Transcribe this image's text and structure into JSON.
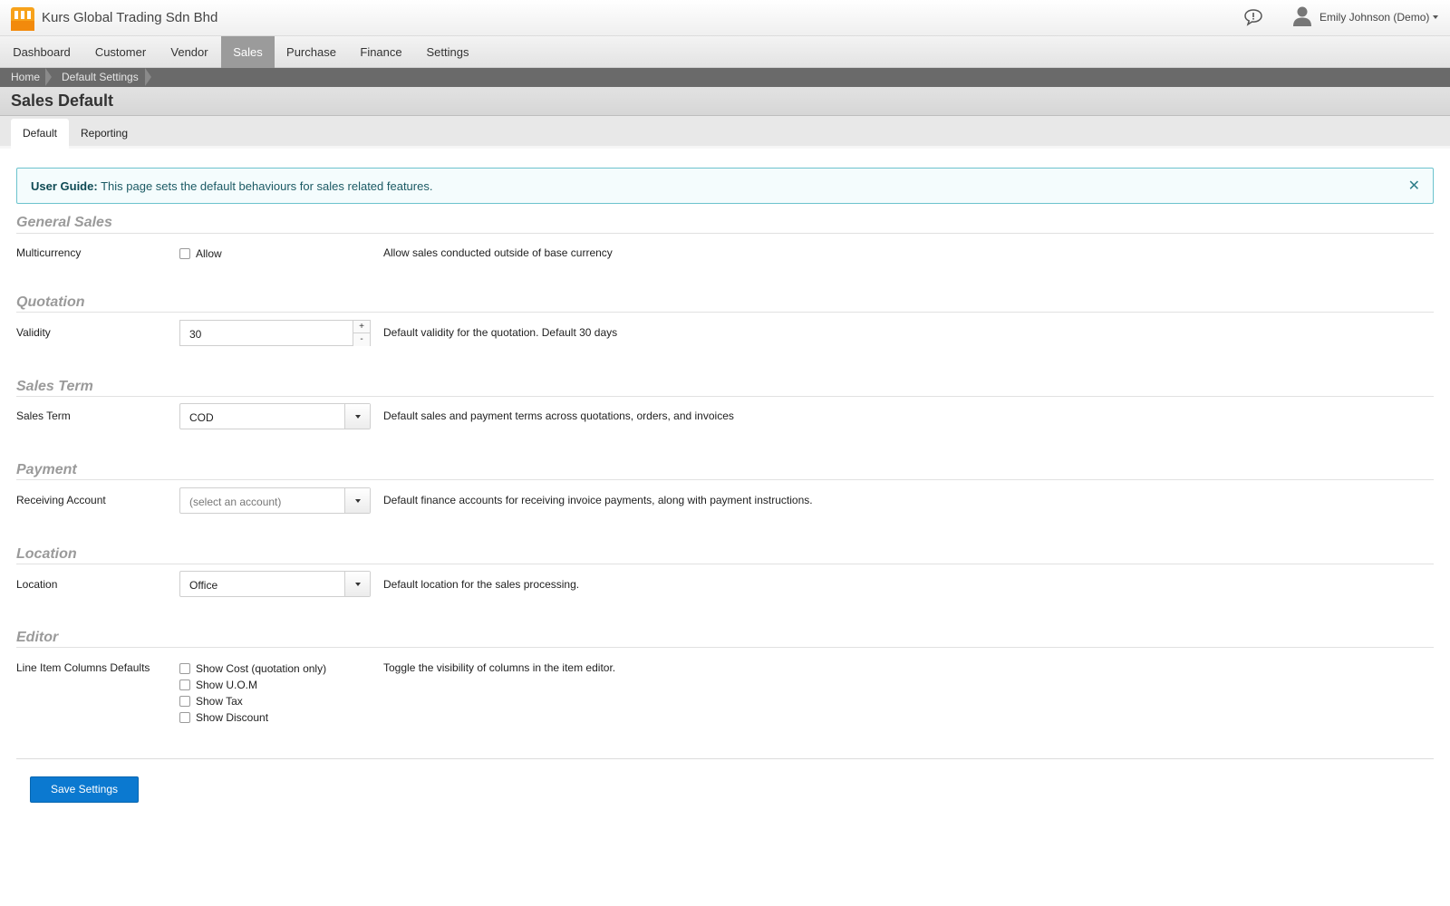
{
  "app": {
    "company_name": "Kurs Global Trading Sdn Bhd",
    "user_name": "Emily Johnson (Demo)",
    "logo_color": "#f7a21b"
  },
  "nav": {
    "items": [
      {
        "label": "Dashboard"
      },
      {
        "label": "Customer"
      },
      {
        "label": "Vendor"
      },
      {
        "label": "Sales",
        "active": true
      },
      {
        "label": "Purchase"
      },
      {
        "label": "Finance"
      },
      {
        "label": "Settings"
      }
    ]
  },
  "breadcrumb": {
    "items": [
      "Home",
      "Default Settings"
    ]
  },
  "page": {
    "title": "Sales Default"
  },
  "tabs": [
    {
      "label": "Default",
      "active": true
    },
    {
      "label": "Reporting"
    }
  ],
  "alert": {
    "strong": "User Guide:",
    "text": "This page sets the default behaviours for sales related features.",
    "close_glyph": "✕"
  },
  "sections": {
    "general": {
      "title": "General Sales",
      "label": "Multicurrency",
      "checkbox_label": "Allow",
      "checked": false,
      "description": "Allow sales conducted outside of base currency"
    },
    "quotation": {
      "title": "Quotation",
      "label": "Validity",
      "value": "30",
      "up": "+",
      "down": "-",
      "description": "Default validity for the quotation. Default 30 days"
    },
    "sales_term": {
      "title": "Sales Term",
      "label": "Sales Term",
      "value": "COD",
      "description": "Default sales and payment terms across quotations, orders, and invoices"
    },
    "payment": {
      "title": "Payment",
      "label": "Receiving Account",
      "placeholder": "(select an account)",
      "description": "Default finance accounts for receiving invoice payments, along with payment instructions."
    },
    "location": {
      "title": "Location",
      "label": "Location",
      "value": "Office",
      "description": "Default location for the sales processing."
    },
    "editor": {
      "title": "Editor",
      "label": "Line Item Columns Defaults",
      "options": [
        {
          "label": "Show Cost (quotation only)",
          "checked": false
        },
        {
          "label": "Show U.O.M",
          "checked": false
        },
        {
          "label": "Show Tax",
          "checked": false
        },
        {
          "label": "Show Discount",
          "checked": false
        }
      ],
      "description": "Toggle the visibility of columns in the item editor."
    }
  },
  "actions": {
    "save_label": "Save Settings",
    "primary_color": "#0b79d0"
  }
}
